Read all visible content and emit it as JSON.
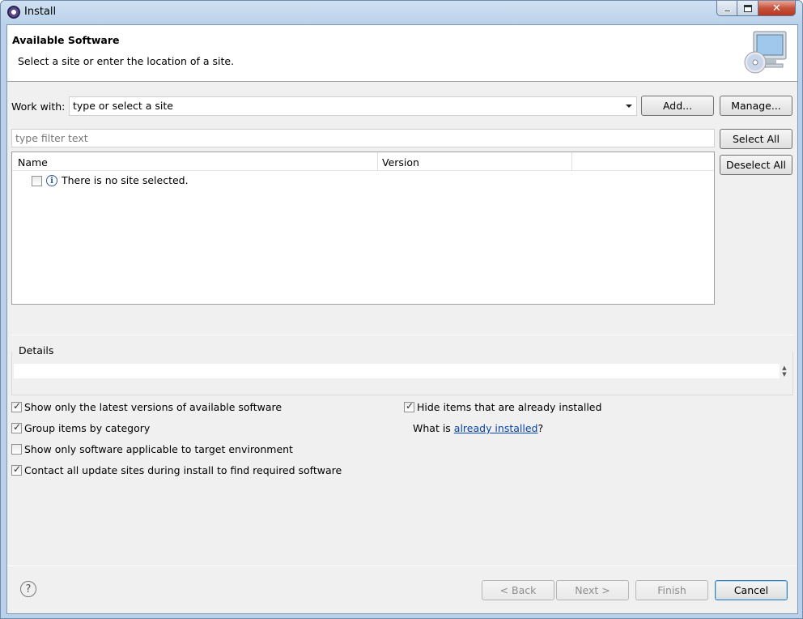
{
  "window": {
    "title": "Install",
    "icon": "eclipse-icon",
    "controls": [
      "minimize-icon",
      "maximize-icon",
      "close-icon"
    ]
  },
  "banner": {
    "title": "Available Software",
    "subtitle": "Select a site or enter the location of a site.",
    "icon": "install-software-icon"
  },
  "work_with": {
    "label": "Work with:",
    "value": "type or select a site",
    "add_label": "Add...",
    "manage_label": "Manage..."
  },
  "filter": {
    "placeholder": "type filter text"
  },
  "selection_buttons": {
    "select_all": "Select All",
    "deselect_all": "Deselect All"
  },
  "table": {
    "columns": [
      "Name",
      "Version"
    ],
    "rows": [
      {
        "checked": false,
        "icon": "info-icon",
        "name": "There is no site selected.",
        "version": ""
      }
    ]
  },
  "details": {
    "label": "Details",
    "text": ""
  },
  "options_left": [
    {
      "label": "Show only the latest versions of available software",
      "checked": true
    },
    {
      "label": "Group items by category",
      "checked": true
    },
    {
      "label": "Show only software applicable to target environment",
      "checked": false
    },
    {
      "label": "Contact all update sites during install to find required software",
      "checked": true
    }
  ],
  "options_right": {
    "hide_installed": {
      "label": "Hide items that are already installed",
      "checked": true
    },
    "what_is_prefix": "What is ",
    "what_is_link": "already installed",
    "what_is_suffix": "?"
  },
  "footer": {
    "help_icon": "help-icon",
    "back_label": "< Back",
    "next_label": "Next >",
    "finish_label": "Finish",
    "cancel_label": "Cancel"
  }
}
